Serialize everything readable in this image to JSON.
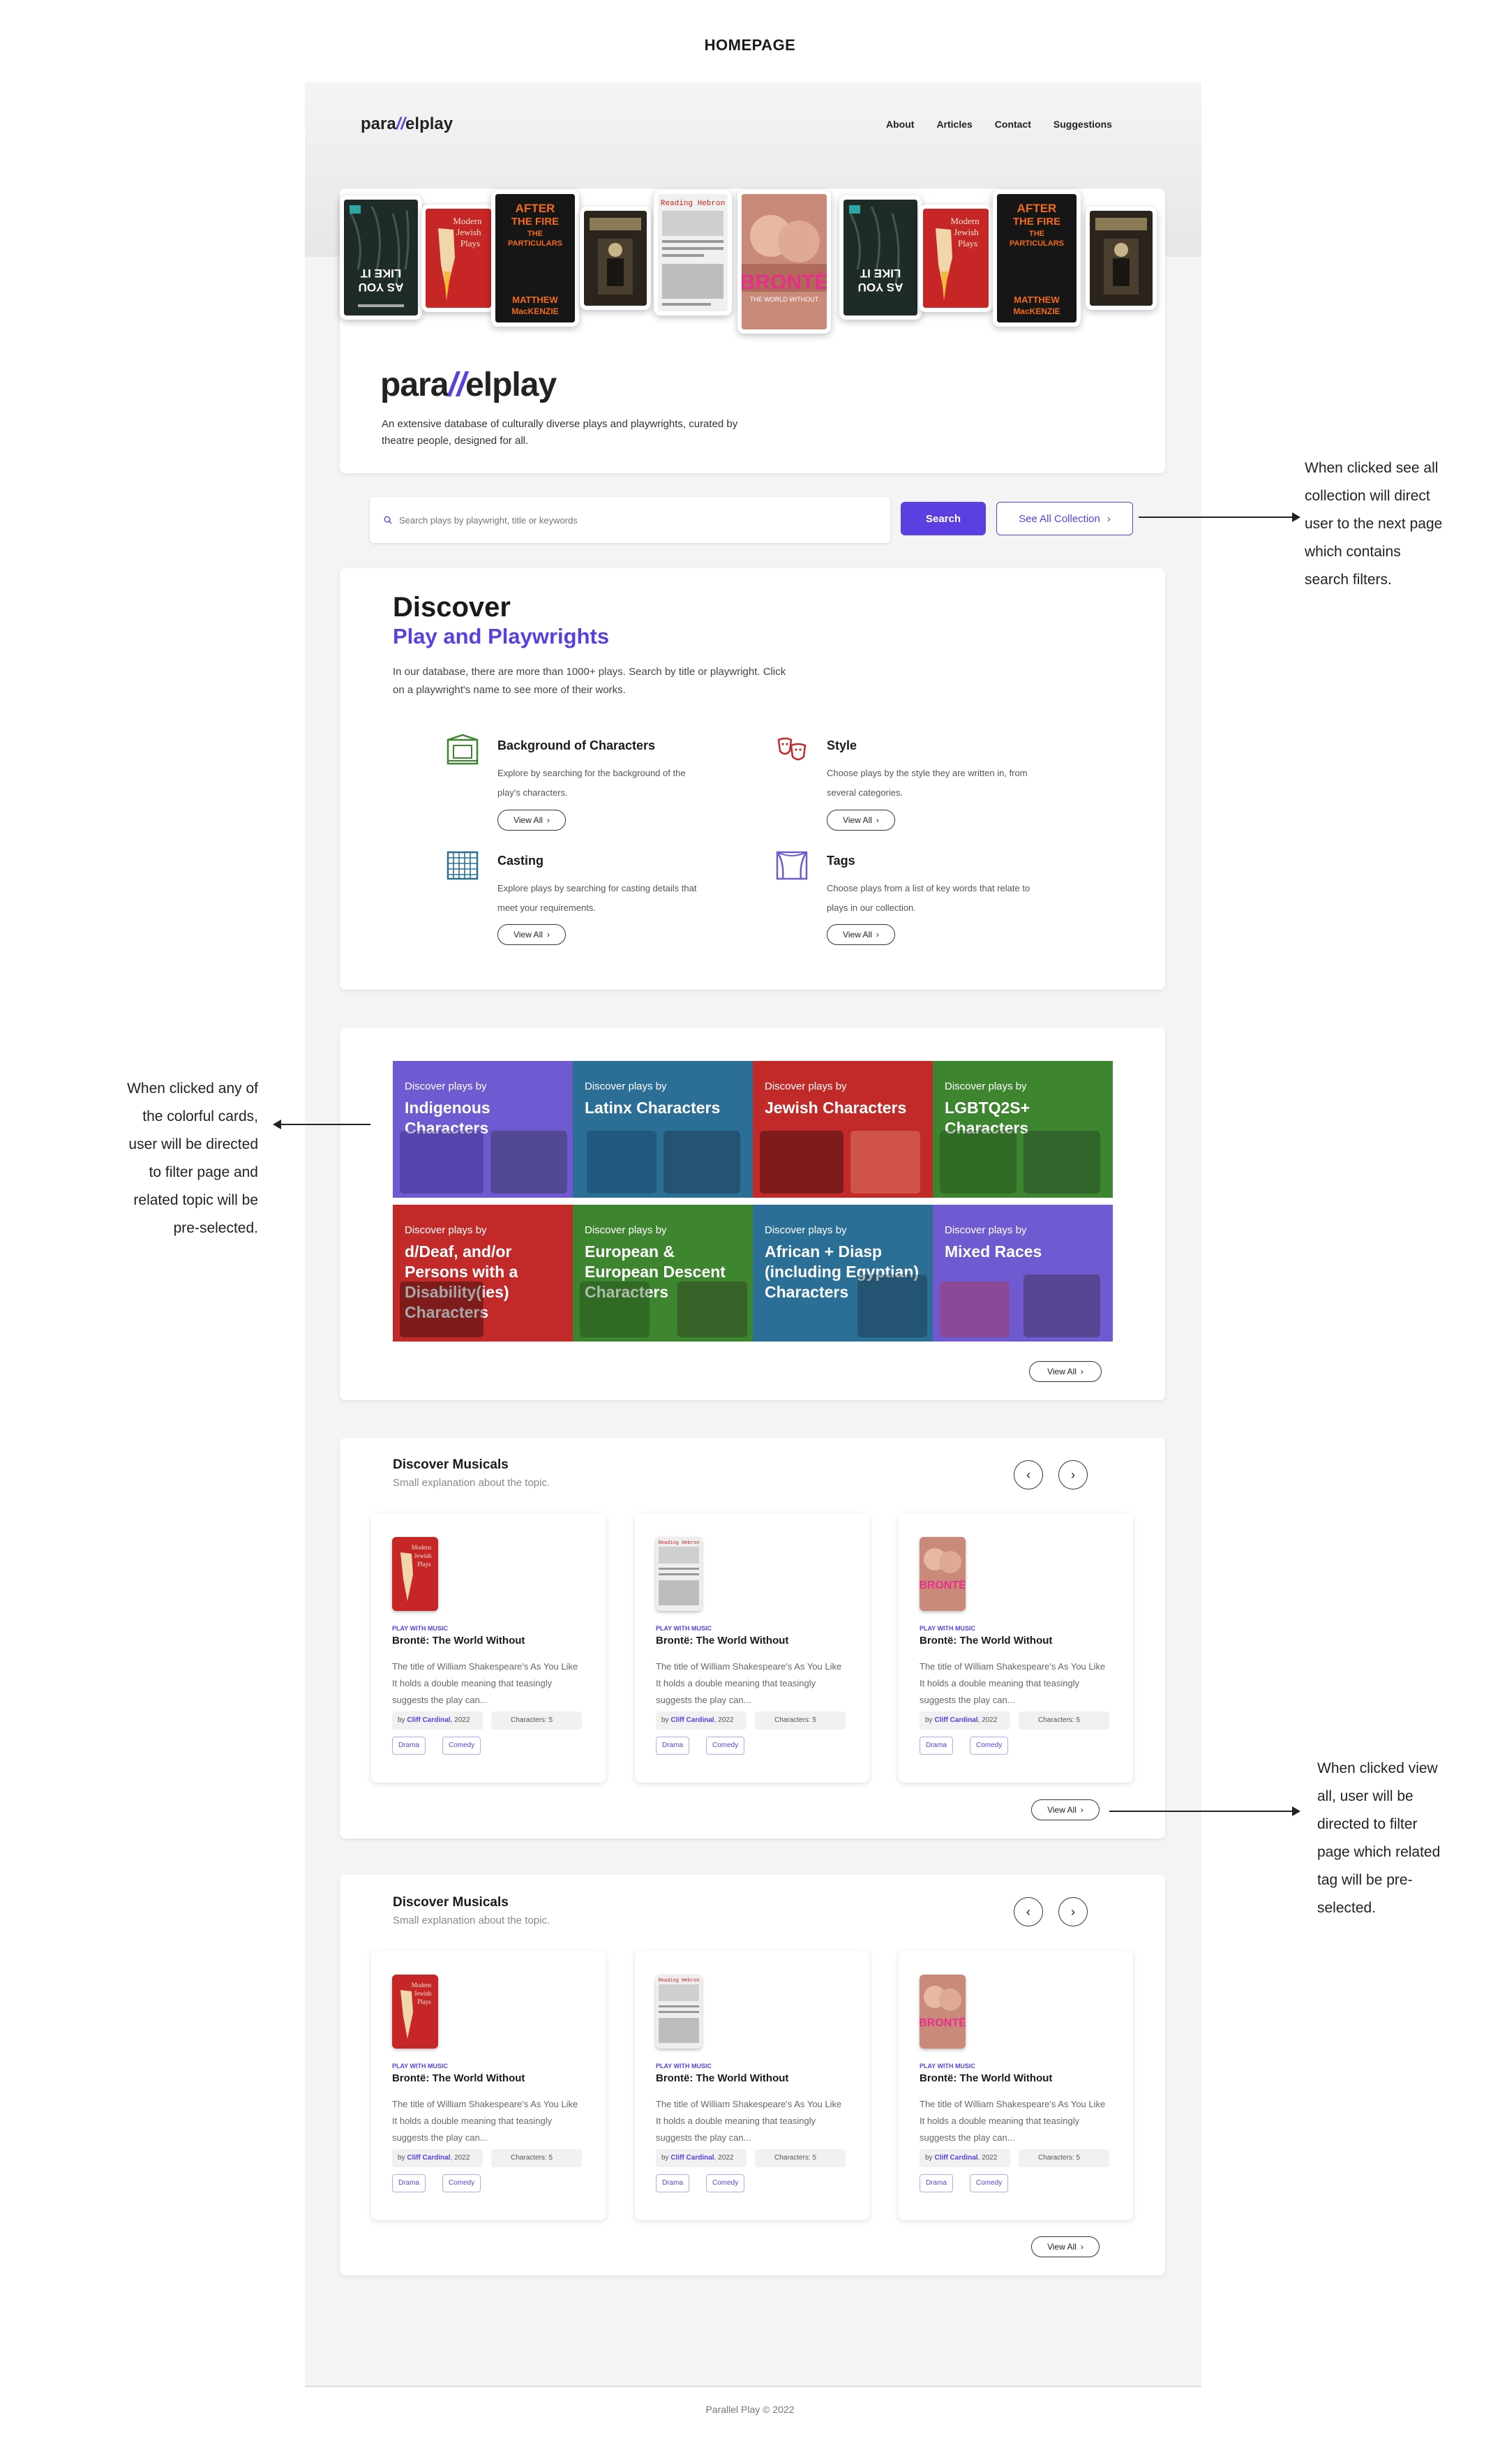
{
  "page_title": "HOMEPAGE",
  "header": {
    "logo_left": "para",
    "logo_slash": "//",
    "logo_right": "elplay",
    "nav": [
      "About",
      "Articles",
      "Contact",
      "Suggestions"
    ]
  },
  "hero": {
    "tagline": "An extensive database of culturally diverse plays and playwrights, curated by theatre people, designed for all."
  },
  "search": {
    "placeholder": "Search plays by playwright, title or keywords",
    "button": "Search",
    "collection_button": "See All Collection"
  },
  "discover": {
    "title": "Discover",
    "subtitle": "Play and Playwrights",
    "description": "In our  database,  there  are  more than 1000+  plays. Search by title or playwright. Click on a playwright's name  to see more of their works.",
    "view_all": "View All",
    "categories": [
      {
        "title": "Background of Characters",
        "desc": "Explore by searching for the background of the play's characters.",
        "icon": "theater-building-icon"
      },
      {
        "title": "Style",
        "desc": "Choose plays by the style they are written in, from several categories.",
        "icon": "theater-masks-icon"
      },
      {
        "title": "Casting",
        "desc": "Explore plays by searching for casting details that meet your requirements.",
        "icon": "seating-grid-icon"
      },
      {
        "title": "Tags",
        "desc": "Choose plays from a list of key words that relate to plays in our collection.",
        "icon": "stage-curtain-icon"
      }
    ]
  },
  "tiles": {
    "prefix": "Discover plays by",
    "items": [
      {
        "label": "Indigenous Characters",
        "color": "#6f5ad1"
      },
      {
        "label": "Latinx Characters",
        "color": "#2b6f97"
      },
      {
        "label": "Jewish Characters",
        "color": "#c22a2a"
      },
      {
        "label": "LGBTQ2S+ Characters",
        "color": "#3e8530"
      },
      {
        "label": "d/Deaf, and/or Persons with a Disability(ies) Characters",
        "color": "#c22a2a"
      },
      {
        "label": "European & European Descent Characters",
        "color": "#3e8530"
      },
      {
        "label": "African + Diasp (including Egyptian) Characters",
        "color": "#2b6f97"
      },
      {
        "label": "Mixed Races",
        "color": "#6f5ad1"
      }
    ],
    "view_all": "View All"
  },
  "musicals": [
    {
      "title": "Discover Musicals",
      "subtitle": "Small explanation about the topic.",
      "view_all": "View All",
      "cards": [
        {
          "tag": "PLAY WITH MUSIC",
          "title": "Brontë: The World Without",
          "desc": "The title of William Shakespeare's As You Like It holds a double meaning that teasingly suggests the play can...",
          "by": "by",
          "author": "Cliff Cardinal",
          "year": ", 2022",
          "characters": "Characters: 5",
          "chips": [
            "Drama",
            "Comedy"
          ]
        },
        {
          "tag": "PLAY WITH MUSIC",
          "title": "Brontë: The World Without",
          "desc": "The title of William Shakespeare's As You Like It holds a double meaning that teasingly suggests the play can...",
          "by": "by",
          "author": "Cliff Cardinal",
          "year": ", 2022",
          "characters": "Characters: 5",
          "chips": [
            "Drama",
            "Comedy"
          ]
        },
        {
          "tag": "PLAY WITH MUSIC",
          "title": "Brontë: The World Without",
          "desc": "The title of William Shakespeare's As You Like It holds a double meaning that teasingly suggests the play can...",
          "by": "by",
          "author": "Cliff Cardinal",
          "year": ", 2022",
          "characters": "Characters: 5",
          "chips": [
            "Drama",
            "Comedy"
          ]
        }
      ]
    },
    {
      "title": "Discover Musicals",
      "subtitle": "Small explanation about the topic.",
      "view_all": "View All",
      "cards": [
        {
          "tag": "PLAY WITH MUSIC",
          "title": "Brontë: The World Without",
          "desc": "The title of William Shakespeare's As You Like It holds a double meaning that teasingly suggests the play can...",
          "by": "by",
          "author": "Cliff Cardinal",
          "year": ", 2022",
          "characters": "Characters: 5",
          "chips": [
            "Drama",
            "Comedy"
          ]
        },
        {
          "tag": "PLAY WITH MUSIC",
          "title": "Brontë: The World Without",
          "desc": "The title of William Shakespeare's As You Like It holds a double meaning that teasingly suggests the play can...",
          "by": "by",
          "author": "Cliff Cardinal",
          "year": ", 2022",
          "characters": "Characters: 5",
          "chips": [
            "Drama",
            "Comedy"
          ]
        },
        {
          "tag": "PLAY WITH MUSIC",
          "title": "Brontë: The World Without",
          "desc": "The title of William Shakespeare's As You Like It holds a double meaning that teasingly suggests the play can...",
          "by": "by",
          "author": "Cliff Cardinal",
          "year": ", 2022",
          "characters": "Characters: 5",
          "chips": [
            "Drama",
            "Comedy"
          ]
        }
      ]
    }
  ],
  "annotations": {
    "collection": [
      "When clicked see all",
      "collection will direct",
      "user to the next page",
      "which contains",
      "search filters."
    ],
    "tiles": [
      "When clicked any of",
      "the colorful cards,",
      "user will be directed",
      "to filter page and",
      "related topic will be",
      "pre-selected."
    ],
    "viewall": [
      "When clicked view",
      "all, user will be",
      "directed to filter",
      "page which related",
      "tag will be pre-",
      "selected."
    ]
  },
  "footer": "Parallel Play © 2022",
  "book_covers": {
    "as_you_like_it": "AS YOU LIKE IT",
    "modern_jewish": "Modern Jewish Plays",
    "after_the_fire": "AFTER THE FIRE THE PARTICULARS",
    "matthew": "MATTHEW MacKENZIE",
    "reading_hebron": "Reading Hebron",
    "bronte": "BRONTË",
    "bronte_sub": "THE WORLD WITHOUT"
  },
  "colors": {
    "accent": "#5b3fe0"
  }
}
